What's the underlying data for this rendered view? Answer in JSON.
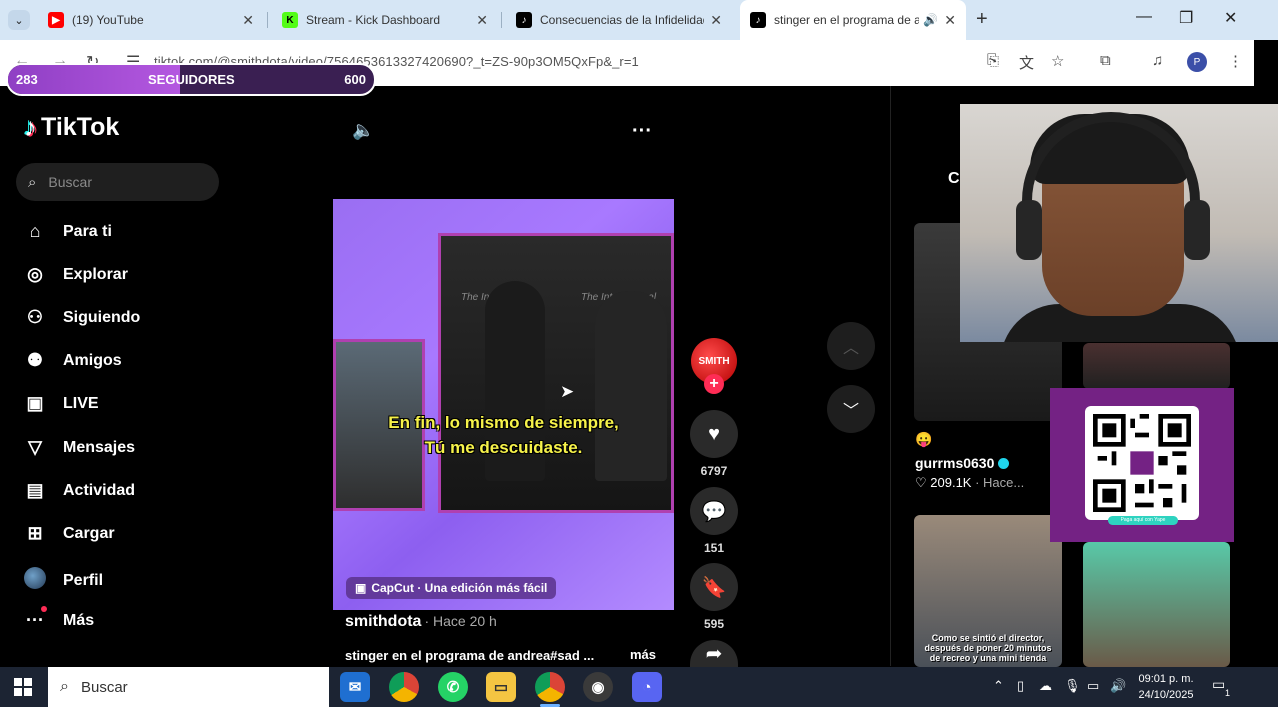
{
  "browser": {
    "tabs": [
      {
        "label": "(19) YouTube",
        "icon": "youtube-icon",
        "color": "#ff0000"
      },
      {
        "label": "Stream - Kick Dashboard",
        "icon": "kick-icon",
        "color": "#53fc18"
      },
      {
        "label": "Consecuencias de la Infidelidad",
        "icon": "tiktok-icon",
        "color": "#000000"
      },
      {
        "label": "stinger en el programa de a",
        "icon": "tiktok-icon",
        "color": "#000000",
        "active": true
      }
    ],
    "url": "tiktok.com/@smithdota/video/7564653613327420690?_t=ZS-90p3OM5QxFp&_r=1",
    "profile_initial": "P"
  },
  "followers": {
    "current": "283",
    "label": "SEGUIDORES",
    "goal": "600",
    "progress": 0.47
  },
  "tiktok": {
    "logo": "TikTok",
    "search_placeholder": "Buscar",
    "nav": [
      {
        "label": "Para ti",
        "icon": "home-icon"
      },
      {
        "label": "Explorar",
        "icon": "compass-icon"
      },
      {
        "label": "Siguiendo",
        "icon": "following-icon"
      },
      {
        "label": "Amigos",
        "icon": "friends-icon"
      },
      {
        "label": "LIVE",
        "icon": "live-icon"
      },
      {
        "label": "Mensajes",
        "icon": "messages-icon"
      },
      {
        "label": "Actividad",
        "icon": "activity-icon"
      },
      {
        "label": "Cargar",
        "icon": "upload-icon"
      },
      {
        "label": "Perfil",
        "icon": "profile-avatar"
      },
      {
        "label": "Más",
        "icon": "more-icon"
      }
    ]
  },
  "video": {
    "subtitle_line1": "En fin, lo mismo de siempre,",
    "subtitle_line2": "Tú me descuidaste.",
    "watermark": "The International",
    "capcut_label": "CapCut · Una edición más fácil",
    "author": "smithdota",
    "time": "· Hace 20 h",
    "caption": "stinger en el programa de andrea#sad ...",
    "more": "más",
    "likes": "6797",
    "comments": "151",
    "saves": "595"
  },
  "right_column": {
    "heading": "C",
    "emoji": "😛",
    "user": "gurrms0630",
    "likes": "♡ 209.1K",
    "time": "· Hace...",
    "thumb_text": "Como se sintió el director, después de poner 20 minutos de recreo y una mini tienda"
  },
  "qr": {
    "caption": "Paga aquí con Yape"
  },
  "taskbar": {
    "search_placeholder": "Buscar",
    "time": "09:01 p. m.",
    "date": "24/10/2025",
    "notification_count": "1"
  }
}
